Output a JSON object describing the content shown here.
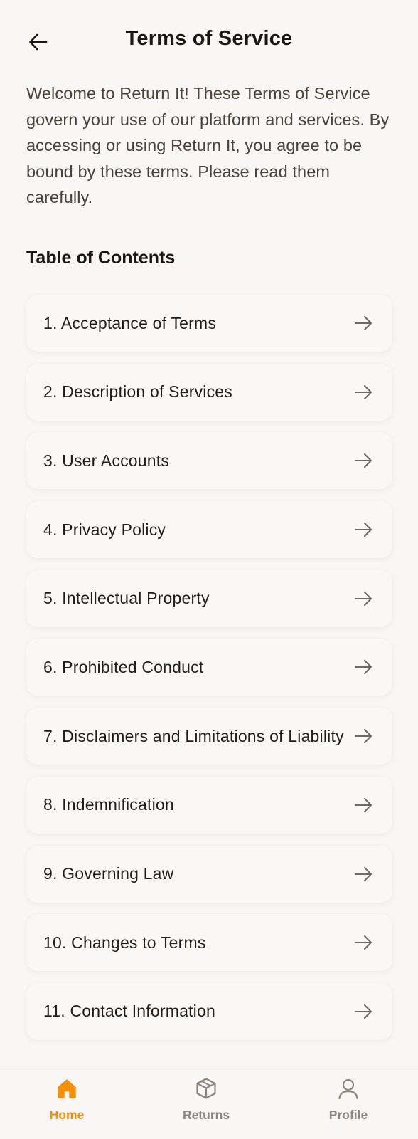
{
  "header": {
    "back_icon": "arrow-left-icon",
    "title": "Terms of Service"
  },
  "intro": "Welcome to Return It! These Terms of Service govern your use of our platform and services. By accessing or using Return It, you agree to be bound by these terms. Please read them carefully.",
  "toc": {
    "title": "Table of Contents",
    "item_icon": "arrow-right-icon",
    "items": [
      "1. Acceptance of Terms",
      "2. Description of Services",
      "3. User Accounts",
      "4. Privacy Policy",
      "5. Intellectual Property",
      "6. Prohibited Conduct",
      "7. Disclaimers and Limitations of Liability",
      "8. Indemnification",
      "9. Governing Law",
      "10. Changes to Terms",
      "11. Contact Information"
    ]
  },
  "bottom_nav": {
    "items": [
      {
        "label": "Home",
        "icon": "home-icon",
        "active": true
      },
      {
        "label": "Returns",
        "icon": "package-icon",
        "active": false
      },
      {
        "label": "Profile",
        "icon": "user-icon",
        "active": false
      }
    ]
  },
  "colors": {
    "accent": "#f5900e",
    "inactive": "#8c8580",
    "background": "#f8f7f5",
    "text": "#1c1714"
  }
}
